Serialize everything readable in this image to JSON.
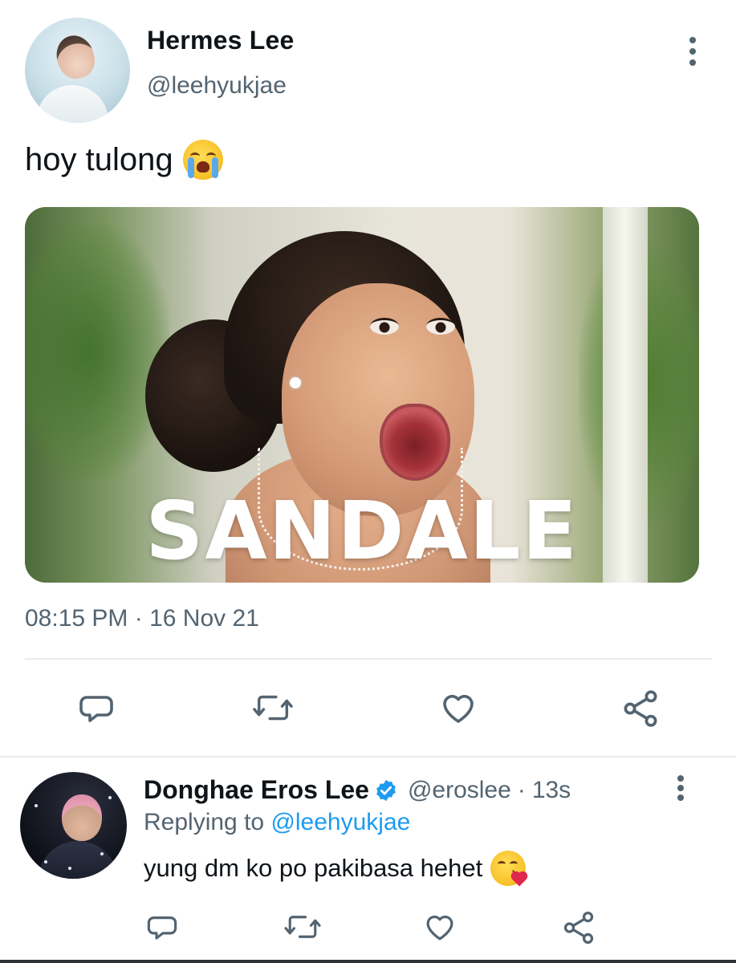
{
  "main_tweet": {
    "author_name": "Hermes Lee",
    "author_handle": "@leehyukjae",
    "text": "hoy tulong",
    "text_emoji": "loudly-crying-face",
    "media_overlay_text": "SANDALE",
    "timestamp": "08:15 PM · 16 Nov 21",
    "more_icon": "more-vertical-icon",
    "actions": [
      {
        "icon": "reply-icon"
      },
      {
        "icon": "retweet-icon"
      },
      {
        "icon": "like-icon"
      },
      {
        "icon": "share-icon"
      }
    ]
  },
  "reply": {
    "author_name": "Donghae Eros Lee",
    "verified": true,
    "author_handle": "@eroslee",
    "separator": "·",
    "time_ago": "13s",
    "replying_prefix": "Replying to",
    "replying_to": "@leehyukjae",
    "text": "yung dm ko po pakibasa hehet",
    "text_emoji": "face-blowing-a-kiss",
    "more_icon": "more-vertical-icon",
    "actions": [
      {
        "icon": "reply-icon"
      },
      {
        "icon": "retweet-icon"
      },
      {
        "icon": "like-icon"
      },
      {
        "icon": "share-icon"
      }
    ]
  },
  "colors": {
    "text_primary": "#0f1419",
    "text_secondary": "#536471",
    "accent_blue": "#1d9bf0",
    "icon_gray": "#536471",
    "divider": "#e6ecf0"
  }
}
